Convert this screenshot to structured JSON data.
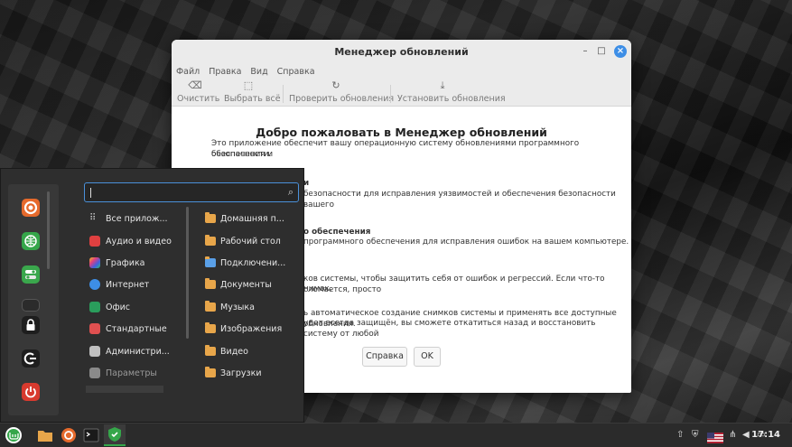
{
  "window": {
    "title": "Менеджер обновлений",
    "menu": [
      "Файл",
      "Правка",
      "Вид",
      "Справка"
    ],
    "toolbar": {
      "clear": "Очистить",
      "select_all": "Выбрать всё",
      "check": "Проверить обновления",
      "install": "Установить обновления"
    },
    "welcome_title": "Добро пожаловать в Менеджер обновлений",
    "intro_line1": "Это приложение обеспечит вашу операционную систему обновлениями программного обеспечения и",
    "intro_line2": "безопасности.",
    "sec_head": "и",
    "sec_text": "безопасности для исправления уязвимостей и обеспечения безопасности вашего",
    "sec_text2": "",
    "sw_head": "о обеспечения",
    "sw_text": "программного обеспечения для исправления ошибок на вашем компьютере.",
    "snap_text1": "ков системы, чтобы защитить себя от ошибок и регрессий. Если что-то сломается, просто",
    "snap_text2": "нимок.",
    "auto_text1": "ь автоматическое создание снимков системы и применять все доступные обновления.",
    "auto_text2": "удет всегда защищён, вы сможете откатиться назад и восстановить систему от любой",
    "auto_text3": "",
    "help_button": "Справка",
    "ok_button": "OK"
  },
  "menu": {
    "search_placeholder": "",
    "categories": [
      {
        "label": "Все прилож...",
        "icon": "grid-icon",
        "color": "#cfcfcf"
      },
      {
        "label": "Аудио и видео",
        "icon": "media-icon",
        "color": "#e04040"
      },
      {
        "label": "Графика",
        "icon": "graphics-icon",
        "color": "#d040c0"
      },
      {
        "label": "Интернет",
        "icon": "internet-icon",
        "color": "#3d8ee6"
      },
      {
        "label": "Офис",
        "icon": "office-icon",
        "color": "#2a9d5c"
      },
      {
        "label": "Стандартные",
        "icon": "accessories-icon",
        "color": "#e05050"
      },
      {
        "label": "Администри...",
        "icon": "admin-icon",
        "color": "#c0c0c0"
      },
      {
        "label": "Параметры",
        "icon": "settings-icon",
        "color": "#8a8a8a"
      }
    ],
    "places": [
      "Домашняя п...",
      "Рабочий стол",
      "Подключени...",
      "Документы",
      "Музыка",
      "Изображения",
      "Видео",
      "Загрузки"
    ]
  },
  "taskbar": {
    "clock": "17:14"
  },
  "colors": {
    "accent": "#3d8ee6",
    "folder": "#e8a64a",
    "mint_green": "#35a64a",
    "firefox_orange": "#e66a2c",
    "power_red": "#d83a2e"
  }
}
